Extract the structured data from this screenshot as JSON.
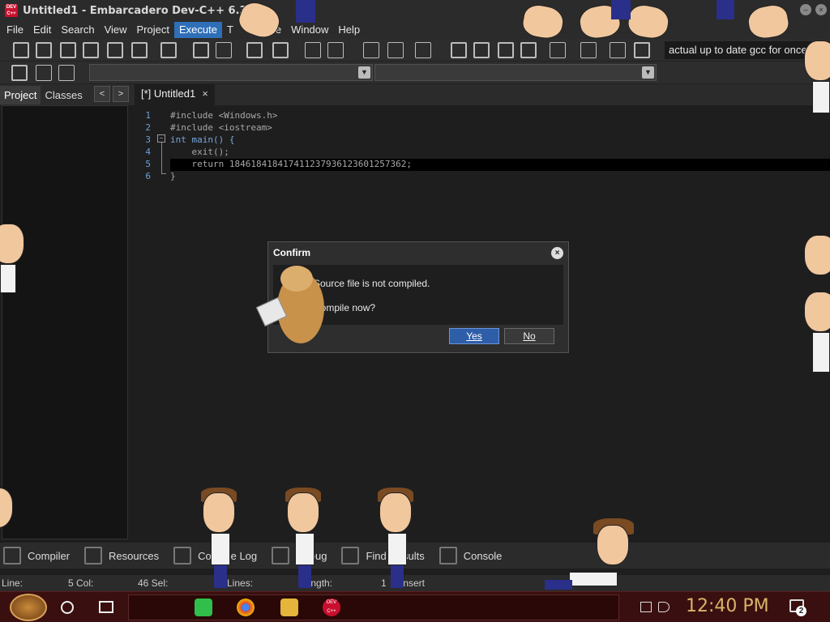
{
  "window": {
    "title": "Untitled1 - Embarcadero Dev-C++ 6.3",
    "app_icon_text": "DEV C++"
  },
  "menu": [
    "File",
    "Edit",
    "Search",
    "View",
    "Project",
    "Execute",
    "T",
    "e",
    "Window",
    "Help"
  ],
  "menu_active": "Execute",
  "toolbar": {
    "compiler_label": "actual up to date gcc for once"
  },
  "left_panel": {
    "tabs": [
      "Project",
      "Classes"
    ],
    "nav_prev": "<",
    "nav_next": ">"
  },
  "editor": {
    "tab_label": "[*] Untitled1",
    "tab_close": "×",
    "line_numbers": [
      "1",
      "2",
      "3",
      "4",
      "5",
      "6"
    ],
    "lines": [
      "#include <Windows.h>",
      "#include <iostream>",
      "int main() {",
      "    exit();",
      "    return 184618418417411237936123601257362;",
      "}"
    ],
    "highlighted_line": 5
  },
  "bottom_tabs": [
    "Compiler",
    "Resources",
    "Compile Log",
    "Debug",
    "Find Results",
    "Console"
  ],
  "status": {
    "line": "Line:",
    "col": "5 Col:",
    "sel": "46 Sel:",
    "lines": "Lines:",
    "length": "Length:",
    "one": "1",
    "mode": "Insert"
  },
  "dialog": {
    "title": "Confirm",
    "close": "×",
    "message1": "Source file is not compiled.",
    "message2": "Compile now?",
    "yes": "Yes",
    "no": "No"
  },
  "taskbar": {
    "time": "12:40 PM",
    "notification_count": "2",
    "devcpp_icon": "DEV C++"
  }
}
